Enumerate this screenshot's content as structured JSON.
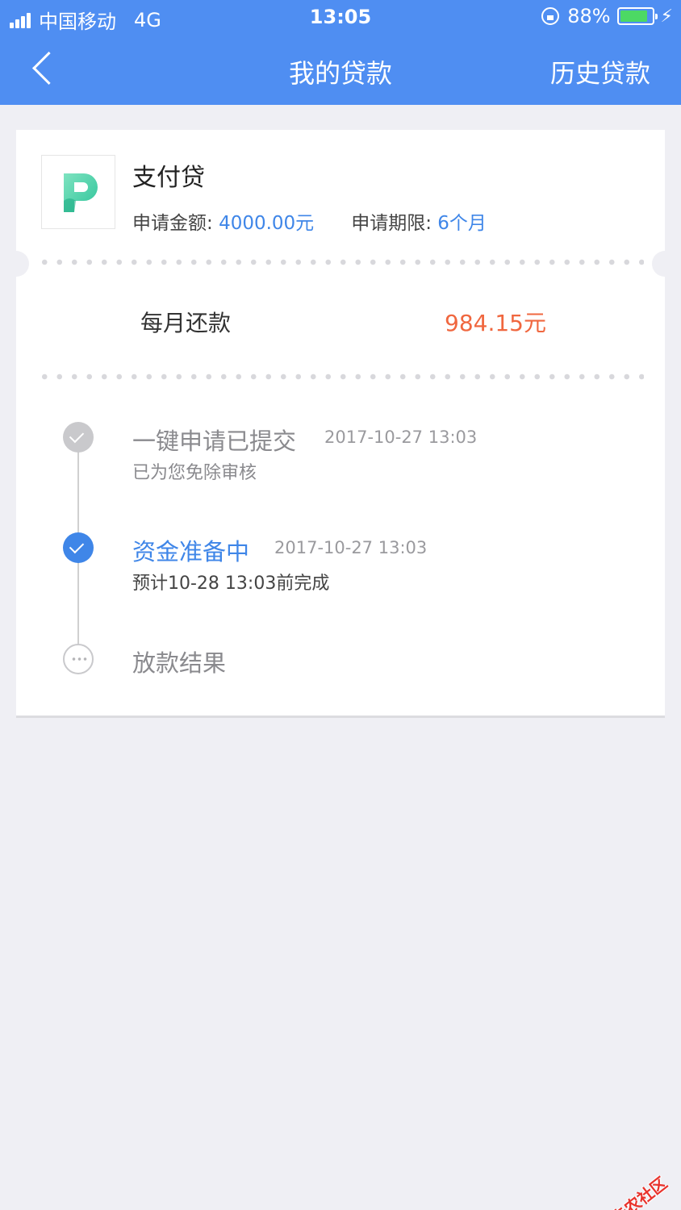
{
  "status_bar": {
    "carrier": "中国移动",
    "network": "4G",
    "time": "13:05",
    "battery": "88%",
    "battery_level": 0.88,
    "icons": [
      "signal-icon",
      "orientation-lock-icon",
      "battery-icon",
      "charging-bolt-icon"
    ]
  },
  "nav": {
    "title": "我的贷款",
    "right_action": "历史贷款",
    "back_icon": "chevron-left-icon"
  },
  "loan": {
    "product_name": "支付贷",
    "amount_label": "申请金额: ",
    "amount_value": "4000.00元",
    "term_label": "申请期限: ",
    "term_value": "6个月",
    "monthly_label": "每月还款",
    "monthly_value": "984.15元"
  },
  "timeline": [
    {
      "title": "一键申请已提交",
      "time": "2017-10-27 13:03",
      "sub": "已为您免除审核",
      "state": "done"
    },
    {
      "title": "资金准备中",
      "time": "2017-10-27 13:03",
      "sub": "预计10-28 13:03前完成",
      "state": "active"
    },
    {
      "title": "放款结果",
      "state": "pending"
    }
  ],
  "watermark": "卡农社区",
  "colors": {
    "header_bg": "#4f8ef2",
    "accent_blue": "#3f86e8",
    "amount_red": "#f0673f",
    "page_bg": "#efeff4"
  }
}
